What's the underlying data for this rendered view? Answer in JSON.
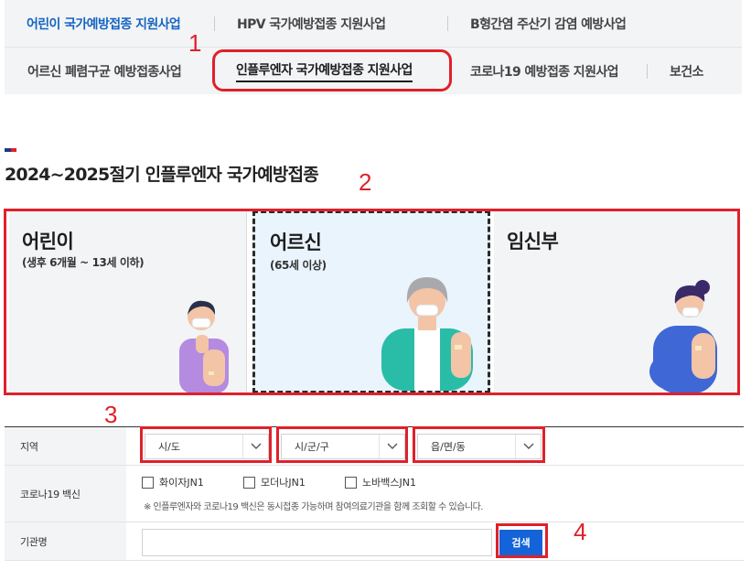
{
  "nav": {
    "row1": [
      {
        "label": "어린이 국가예방접종 지원사업",
        "active": true
      },
      {
        "label": "HPV 국가예방접종 지원사업"
      },
      {
        "label": "B형간염 주산기 감염 예방사업"
      }
    ],
    "row2": [
      {
        "label": "어르신 폐렴구균 예방접종사업"
      },
      {
        "label": "인플루엔자 국가예방접종 지원사업",
        "selected": true
      },
      {
        "label": "코로나19 예방접종 지원사업"
      },
      {
        "label": "보건소"
      }
    ]
  },
  "annotations": [
    "1",
    "2",
    "3",
    "4"
  ],
  "page_title": "2024~2025절기 인플루엔자 국가예방접종",
  "cards": [
    {
      "title": "어린이",
      "subtitle": "(생후 6개월 ~ 13세 이하)"
    },
    {
      "title": "어르신",
      "subtitle": "(65세 이상)",
      "selected": true
    },
    {
      "title": "임신부",
      "subtitle": ""
    }
  ],
  "form": {
    "region": {
      "label": "지역",
      "selects": [
        "시/도",
        "시/군/구",
        "읍/면/동"
      ]
    },
    "covid": {
      "label": "코로나19 백신",
      "options": [
        "화이자JN1",
        "모더나JN1",
        "노바백스JN1"
      ],
      "note": "※ 인플루엔자와 코로나19 백신은 동시접종 가능하며 참여의료기관을 함께 조회할 수 있습니다."
    },
    "institution": {
      "label": "기관명",
      "value": "",
      "button": "검색"
    }
  },
  "colors": {
    "accent_blue": "#1565c0",
    "button_blue": "#1463d8",
    "annotation_red": "#e0202a",
    "selected_card_bg": "#eaf4fd"
  }
}
